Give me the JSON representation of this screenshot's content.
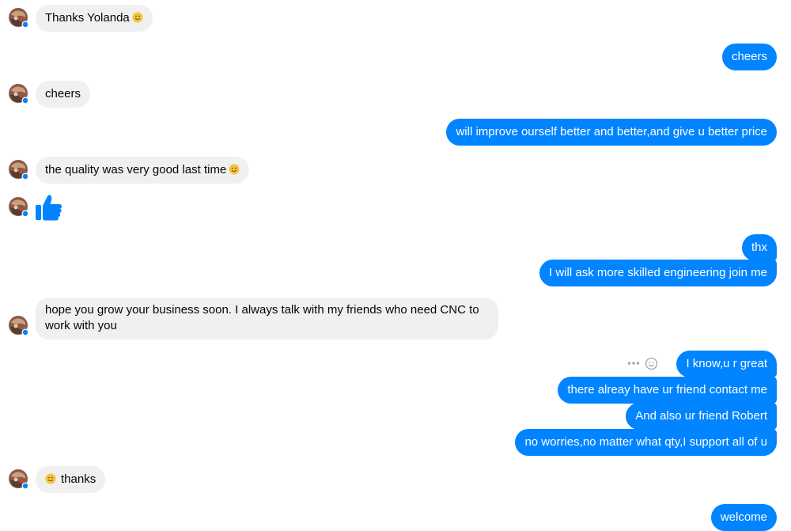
{
  "contact": {
    "avatar_icon": "avatar-photo-icon",
    "online_color": "#0084ff"
  },
  "colors": {
    "outgoing_bubble": "#0084ff",
    "incoming_bubble": "#f0f0f0"
  },
  "messages": [
    {
      "from": "them",
      "text": "Thanks Yolanda",
      "emoji": "slightly-smiling-face"
    },
    {
      "from": "me",
      "text": "cheers"
    },
    {
      "from": "them",
      "text": "cheers"
    },
    {
      "from": "me",
      "text": "will improve ourself better and better,and give u better price"
    },
    {
      "from": "them",
      "text": "the quality was very good last time",
      "emoji": "winking-face"
    },
    {
      "from": "them",
      "sticker": "thumbs-up-icon"
    },
    {
      "from": "me",
      "text": "thx"
    },
    {
      "from": "me",
      "text": "I will ask more skilled engineering join me"
    },
    {
      "from": "them",
      "text": "hope you grow your business soon. I always talk with my friends who need CNC to work with you"
    },
    {
      "from": "me",
      "text": "I know,u r great"
    },
    {
      "from": "me",
      "text": "there alreay have ur friend contact me"
    },
    {
      "from": "me",
      "text": "And also ur friend Robert"
    },
    {
      "from": "me",
      "text": "no worries,no matter what qty,I support all of u"
    },
    {
      "from": "them",
      "text": "thanks",
      "emoji": "winking-face"
    },
    {
      "from": "me",
      "text": "welcome"
    }
  ],
  "hover_actions": [
    "more-options-icon",
    "react-emoji-icon"
  ]
}
